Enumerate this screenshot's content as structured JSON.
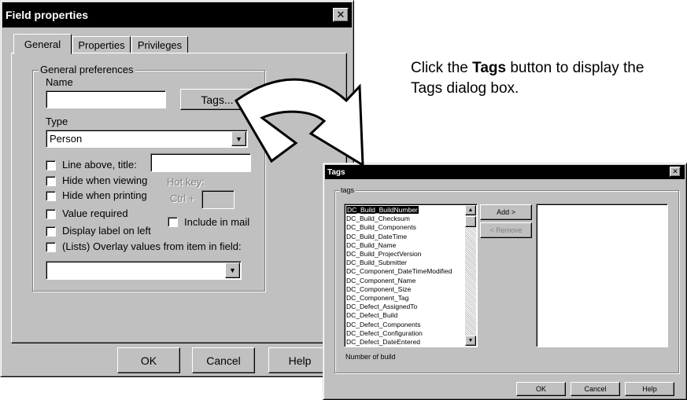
{
  "field_properties": {
    "title": "Field properties",
    "close_glyph": "✕",
    "tabs": [
      "General",
      "Properties",
      "Privileges"
    ],
    "group_label": "General preferences",
    "name_label": "Name",
    "name_value": "",
    "tags_button": "Tags...",
    "type_label": "Type",
    "type_value": "Person",
    "line_above_label": "Line above, title:",
    "line_above_value": "",
    "hide_viewing_label": "Hide when viewing",
    "hotkey_label": "Hot key:",
    "hide_printing_label": "Hide when printing",
    "ctrl_label": "Ctrl +",
    "hotkey_value": "",
    "value_required_label": "Value required",
    "include_mail_label": "Include in mail",
    "display_label_left": "Display label on left",
    "lists_overlay_label": "(Lists) Overlay values from item in field:",
    "overlay_value": "",
    "buttons": {
      "ok": "OK",
      "cancel": "Cancel",
      "help": "Help"
    }
  },
  "instruction": {
    "before": "Click the ",
    "bold": "Tags",
    "after": " button to display the Tags dialog box."
  },
  "tags_dialog": {
    "title": "Tags",
    "close_glyph": "✕",
    "group_label": "tags",
    "items": [
      "DC_Build_BuildNumber",
      "DC_Build_Checksum",
      "DC_Build_Components",
      "DC_Build_DateTime",
      "DC_Build_Name",
      "DC_Build_ProjectVersion",
      "DC_Build_Submitter",
      "DC_Component_DateTimeModified",
      "DC_Component_Name",
      "DC_Component_Size",
      "DC_Component_Tag",
      "DC_Defect_AssignedTo",
      "DC_Defect_Build",
      "DC_Defect_Components",
      "DC_Defect_Configuration",
      "DC_Defect_DateEntered"
    ],
    "selected_index": 0,
    "add_button": "Add >",
    "remove_button": "< Remove",
    "description": "Number of build",
    "buttons": {
      "ok": "OK",
      "cancel": "Cancel",
      "help": "Help"
    }
  }
}
